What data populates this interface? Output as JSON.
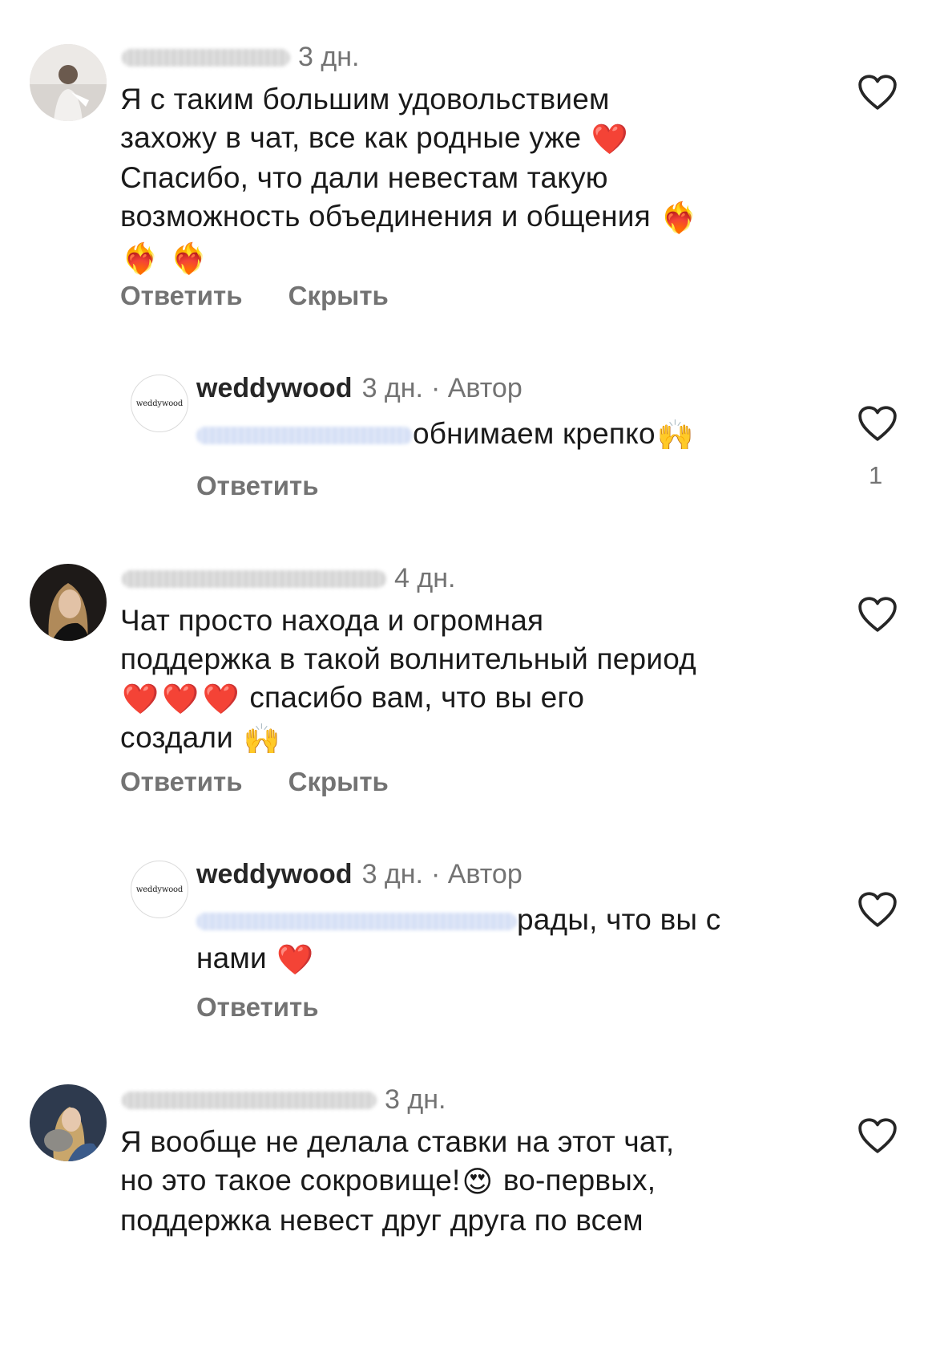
{
  "comments": [
    {
      "time": "3 дн.",
      "lines": [
        "Я с таким большим удовольствием",
        "захожу в чат, все как родные уже",
        "Спасибо, что дали невестам такую",
        "возможность объединения и общения"
      ],
      "emoji_line1": "❤️",
      "emoji_line3": "❤️‍🔥",
      "emoji_line4": [
        "❤️‍🔥",
        "❤️‍🔥"
      ],
      "reply_label": "Ответить",
      "hide_label": "Скрыть"
    },
    {
      "username": "weddywood",
      "time": "3 дн.",
      "author_label": "· Автор",
      "text": "обнимаем крепко",
      "emoji": "🙌",
      "reply_label": "Ответить",
      "likes": "1",
      "logo_text": "weddywood"
    },
    {
      "time": "4 дн.",
      "lines": [
        "Чат просто находа и огромная",
        "поддержка в такой волнительный период",
        "спасибо вам, что вы его",
        "создали"
      ],
      "emoji_hearts": [
        "❤️",
        "❤️",
        "❤️"
      ],
      "emoji_end": "🙌",
      "reply_label": "Ответить",
      "hide_label": "Скрыть"
    },
    {
      "username": "weddywood",
      "time": "3 дн.",
      "author_label": "· Автор",
      "line1": "рады, что вы с",
      "line2": "нами",
      "emoji": "❤️",
      "reply_label": "Ответить",
      "logo_text": "weddywood"
    },
    {
      "time": "3 дн.",
      "lines": [
        "Я вообще не делала ставки на этот чат,",
        "но это такое сокровище!",
        "во-первых,",
        "поддержка невест друг друга по всем"
      ],
      "emoji": "😍"
    }
  ],
  "colors": {
    "text": "#1a1a1a",
    "secondary": "#737373",
    "heart_outline": "#262626"
  },
  "icons": [
    "heart-outline-icon"
  ]
}
